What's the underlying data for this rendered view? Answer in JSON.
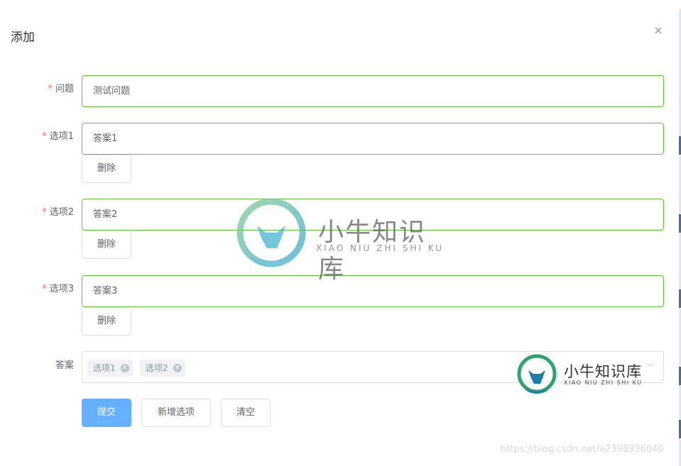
{
  "dialog": {
    "title": "添加",
    "close_glyph": "×"
  },
  "form": {
    "required_mark": "*",
    "question": {
      "label": "问题",
      "value": "测试问题"
    },
    "options": [
      {
        "label": "选项1",
        "value": "答案1",
        "delete_label": "删除"
      },
      {
        "label": "选项2",
        "value": "答案2",
        "delete_label": "删除"
      },
      {
        "label": "选项3",
        "value": "答案3",
        "delete_label": "删除"
      }
    ],
    "answer": {
      "label": "答案",
      "selected": [
        "选项1",
        "选项2"
      ]
    }
  },
  "actions": {
    "submit_label": "提交",
    "add_option_label": "新增选项",
    "clear_label": "清空"
  },
  "watermarks": {
    "brand": "小牛知识库",
    "brand_sub": "XIAO NIU ZHI SHI KU",
    "url": "https://blog.csdn.net/a2398936046"
  },
  "colors": {
    "valid_border": "#67c23a",
    "primary": "#66b1ff",
    "required": "#f56c6c"
  },
  "icons": {
    "close": "close-icon",
    "tag_remove": "circle-close-icon",
    "select_arrow": "chevron-down-icon"
  }
}
